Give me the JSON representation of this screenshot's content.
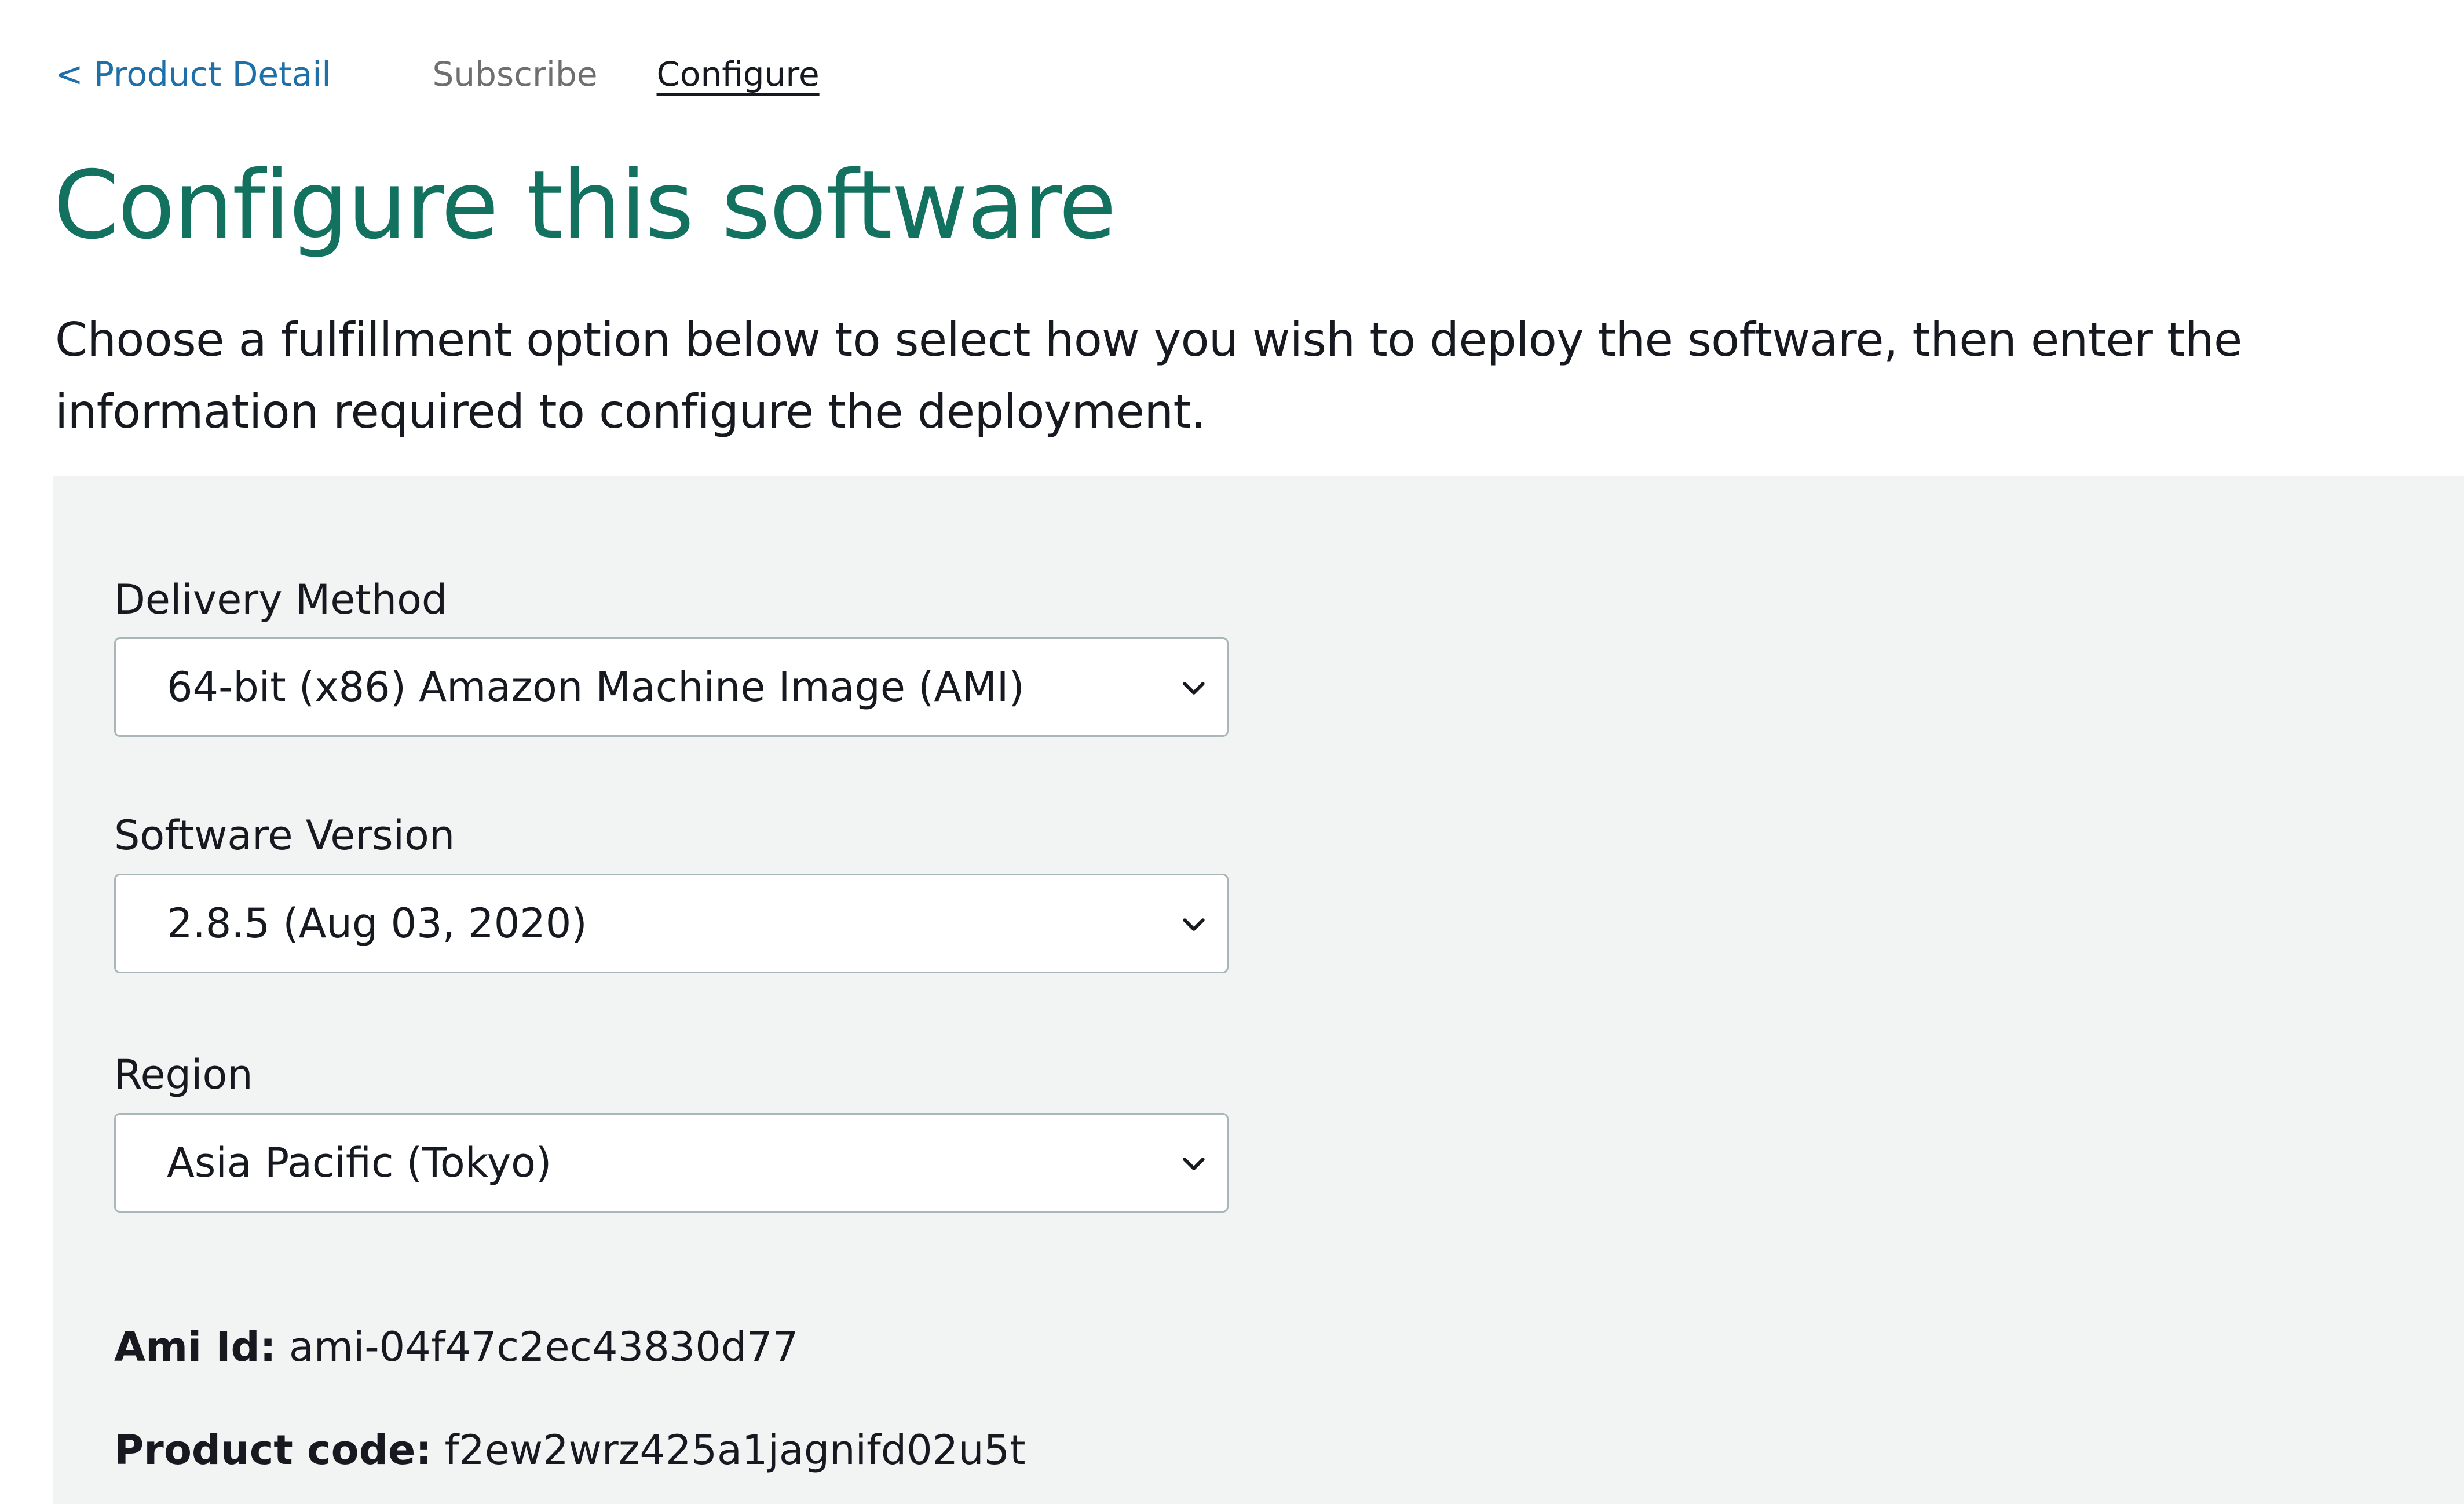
{
  "breadcrumb": {
    "back_label": "< Product Detail",
    "subscribe_label": "Subscribe",
    "configure_label": "Configure"
  },
  "page": {
    "title": "Configure this software",
    "intro": "Choose a fulfillment option below to select how you wish to deploy the software, then enter the information required to configure the deployment."
  },
  "form": {
    "delivery_method": {
      "label": "Delivery Method",
      "value": "64-bit (x86) Amazon Machine Image (AMI)"
    },
    "software_version": {
      "label": "Software Version",
      "value": "2.8.5 (Aug 03, 2020)"
    },
    "region": {
      "label": "Region",
      "value": "Asia Pacific (Tokyo)"
    }
  },
  "details": {
    "ami_id_label": "Ami Id:",
    "ami_id_value": "ami-04f47c2ec43830d77",
    "product_code_label": "Product code:",
    "product_code_value": "f2ew2wrz425a1jagnifd02u5t"
  },
  "icons": {
    "dropdown": "chevron-down-icon"
  },
  "colors": {
    "link": "#1f6fa8",
    "title": "#13725f",
    "panel_background": "#f2f3f3",
    "select_border": "#aab7b8"
  }
}
